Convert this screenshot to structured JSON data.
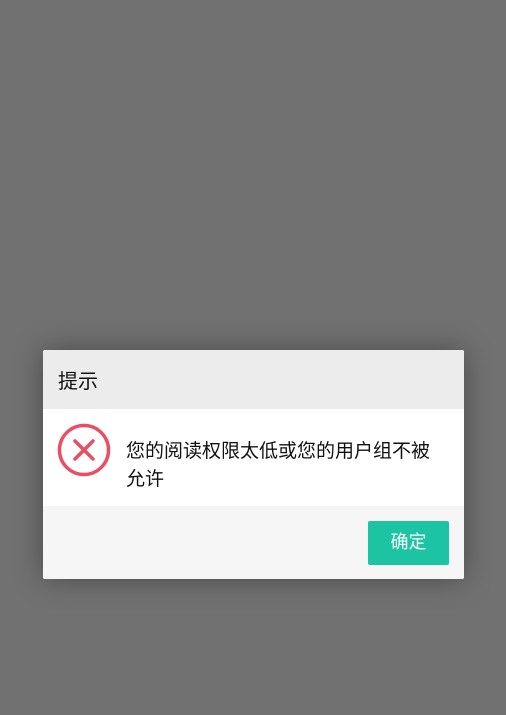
{
  "dialog": {
    "title": "提示",
    "message": "您的阅读权限太低或您的用户组不被允许",
    "icon": "error-circle-x-icon",
    "confirm_label": "确定"
  },
  "colors": {
    "overlay": "#717171",
    "header_bg": "#ececec",
    "footer_bg": "#f6f6f6",
    "error": "#ea4e62",
    "button": "#1cc4a4"
  }
}
